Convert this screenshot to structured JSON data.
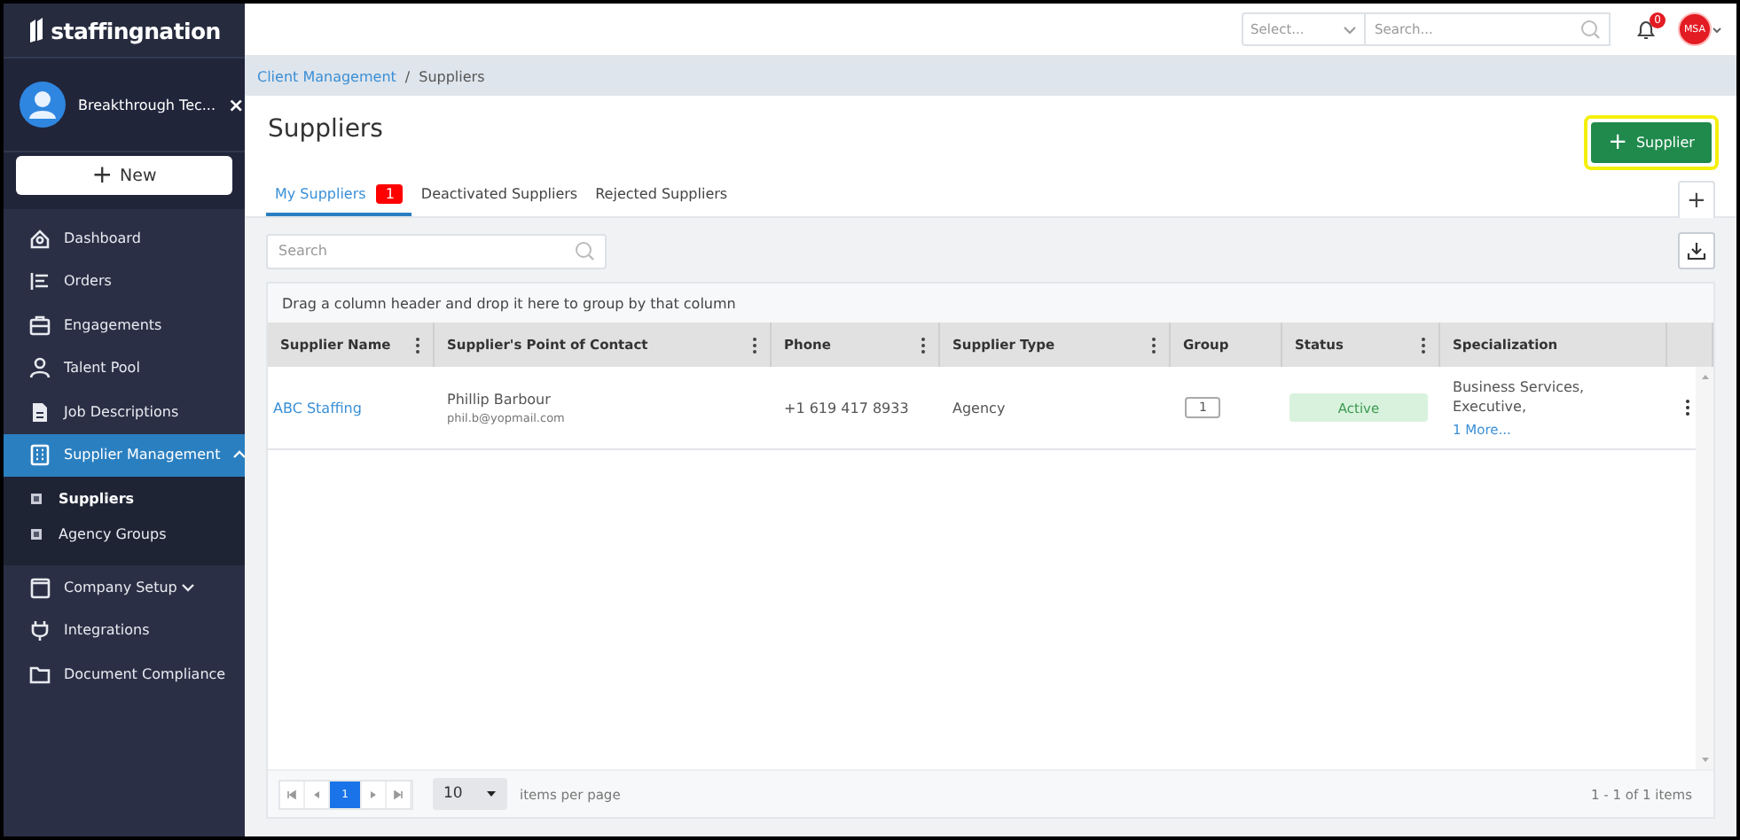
{
  "brand": {
    "name": "staffingnation"
  },
  "account": {
    "name": "Breakthrough Tec...",
    "close": "×"
  },
  "new_button": {
    "label": "New",
    "icon": "+"
  },
  "sidebar": {
    "items": [
      {
        "label": "Dashboard",
        "selected": false
      },
      {
        "label": "Orders",
        "selected": false
      },
      {
        "label": "Engagements",
        "selected": false
      },
      {
        "label": "Talent Pool",
        "selected": false
      },
      {
        "label": "Job Descriptions",
        "selected": false
      },
      {
        "label": "Supplier Management",
        "selected": true,
        "expanded": true,
        "children": [
          {
            "label": "Suppliers",
            "selected": true
          },
          {
            "label": "Agency Groups",
            "selected": false
          }
        ]
      },
      {
        "label": "Company Setup",
        "selected": false,
        "expanded": false
      },
      {
        "label": "Integrations",
        "selected": false
      },
      {
        "label": "Document Compliance",
        "selected": false
      }
    ]
  },
  "header": {
    "select": {
      "placeholder": "Select..."
    },
    "search": {
      "placeholder": "Search..."
    },
    "notifications": {
      "count": "0"
    },
    "avatar": {
      "initials": "MSA"
    }
  },
  "breadcrumb": [
    {
      "label": "Client Management",
      "kind": "link"
    },
    {
      "label": "Suppliers",
      "kind": "current"
    }
  ],
  "breadcrumb_separator": "/",
  "page_title": "Suppliers",
  "add_button": {
    "label": "Supplier",
    "icon": "+",
    "highlighted": true
  },
  "tabs": [
    {
      "label": "My Suppliers",
      "selected": true,
      "badge": "1"
    },
    {
      "label": "Deactivated Suppliers",
      "selected": false
    },
    {
      "label": "Rejected Suppliers",
      "selected": false
    }
  ],
  "add_tab_button": "+",
  "grid_search": {
    "placeholder": "Search"
  },
  "table": {
    "group_hint": "Drag a column header and drop it here to group by that column",
    "columns": [
      {
        "label": "Supplier Name",
        "menu": true
      },
      {
        "label": "Supplier's Point of Contact",
        "menu": true
      },
      {
        "label": "Phone",
        "menu": true
      },
      {
        "label": "Supplier Type",
        "menu": true
      },
      {
        "label": "Group",
        "menu": false
      },
      {
        "label": "Status",
        "menu": true
      },
      {
        "label": "Specialization",
        "menu": false
      }
    ],
    "rows": [
      {
        "name": "ABC Staffing",
        "contact": "Phillip Barbour",
        "email": "phil.b@yopmail.com",
        "phone": "+1 619 417 8933",
        "type": "Agency",
        "group": "1",
        "status": "Active",
        "specialization": [
          "Business Services,",
          "Executive,"
        ],
        "more": "1 More..."
      }
    ]
  },
  "pager": {
    "pages": [
      {
        "label": "1",
        "selected": true
      }
    ],
    "page_size": "10",
    "page_size_label": "items per page",
    "summary": "1 - 1 of 1 items"
  }
}
